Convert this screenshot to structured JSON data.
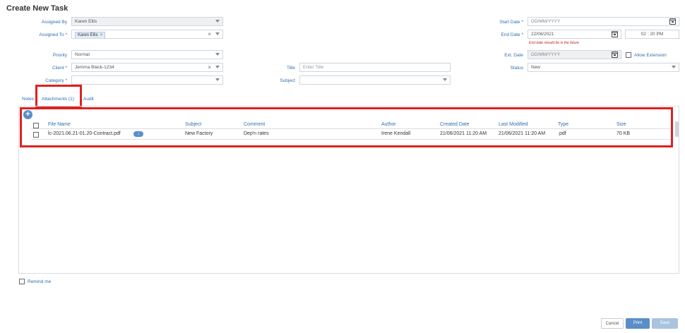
{
  "page": {
    "title": "Create New Task"
  },
  "form": {
    "assigned_by": {
      "label": "Assigned By",
      "value": "Karen Ellis"
    },
    "assigned_to": {
      "label": "Assigned To *",
      "tag": "Karen Ellis",
      "tag_remove": "×",
      "clear": "×"
    },
    "priority": {
      "label": "Priority",
      "value": "Normal"
    },
    "client": {
      "label": "Client *",
      "value": "Jemma Black-1234",
      "clear": "×"
    },
    "category": {
      "label": "Category *",
      "value": ""
    },
    "title": {
      "label": "Title",
      "placeholder": "Enter Title"
    },
    "subject": {
      "label": "Subject",
      "value": ""
    },
    "start_date": {
      "label": "Start Date *",
      "placeholder": "DD/MM/YYYY"
    },
    "end_date": {
      "label": "End Date *",
      "value": "22/06/2021",
      "time": "02 : 20  PM",
      "hint": "End date should be in the future"
    },
    "ext_date": {
      "label": "Ext. Date",
      "placeholder": "DD/MM/YYYY",
      "allow_label": "Allow Extension"
    },
    "status": {
      "label": "Status",
      "value": "New"
    }
  },
  "tabs": [
    {
      "label": "Notes"
    },
    {
      "label": "Attachments (1)"
    },
    {
      "label": "Audit"
    }
  ],
  "attachments": {
    "add_icon": "+",
    "columns": [
      "File Name",
      "Subject",
      "Comment",
      "Author",
      "Created Date",
      "Last Modified",
      "Type",
      "Size"
    ],
    "rows": [
      {
        "file_name": "lc-2021.06.21-01.20-Contract.pdf",
        "subject": "New Factory",
        "comment": "Dep'n rates",
        "author": "Irene Kendall",
        "created": "21/06/2021 11:20 AM",
        "modified": "21/06/2021 11:20 AM",
        "type": ".pdf",
        "size": "70 KB"
      }
    ]
  },
  "remind": {
    "label": "Remind me"
  },
  "buttons": {
    "cancel": "Cancel",
    "print": "Print",
    "save": "Save"
  },
  "colors": {
    "accent": "#2f6fb3",
    "highlight": "#e02020",
    "primary_button": "#5b8ec9",
    "disabled_button": "#a9c3e0"
  }
}
